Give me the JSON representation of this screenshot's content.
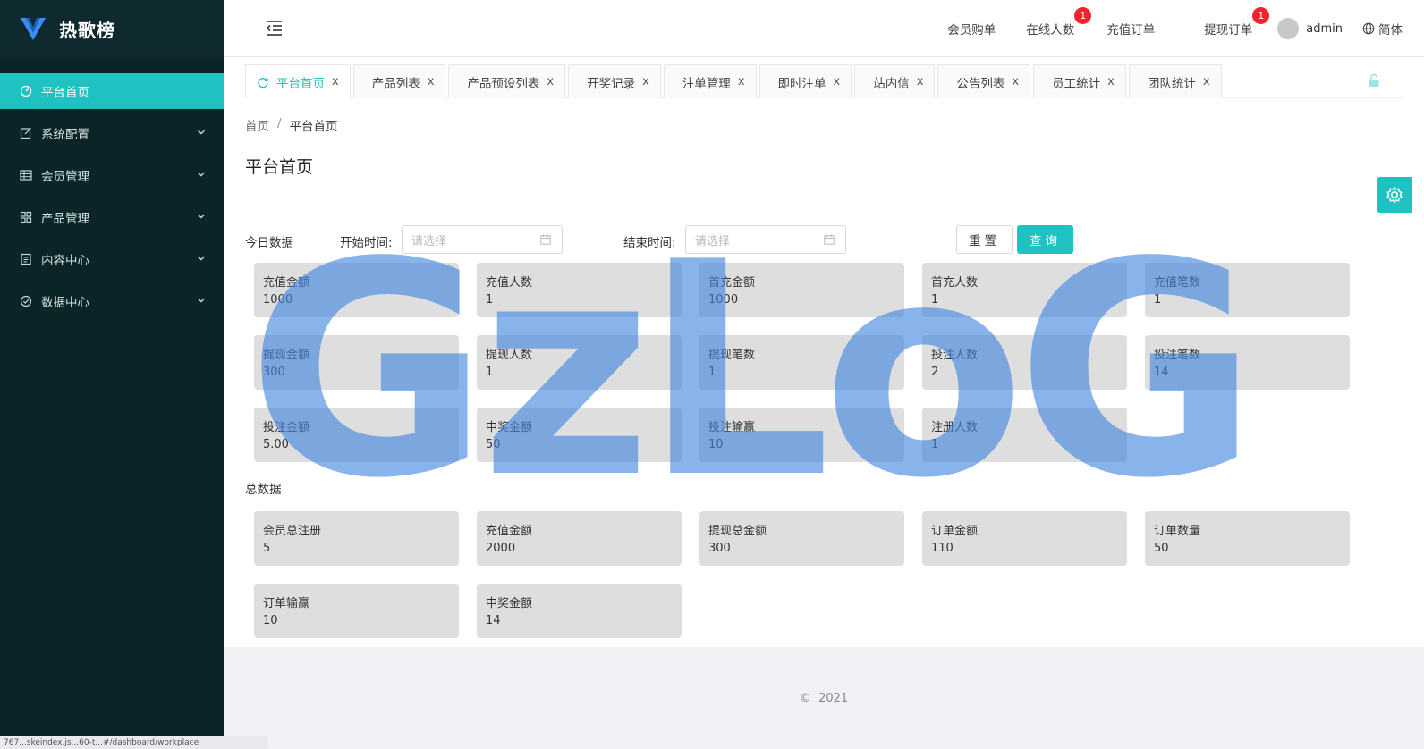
{
  "app": {
    "name": "热歌榜"
  },
  "sidebar": {
    "items": [
      {
        "label": "平台首页",
        "icon": "dashboard-icon"
      },
      {
        "label": "系统配置",
        "icon": "edit-icon"
      },
      {
        "label": "会员管理",
        "icon": "table-icon"
      },
      {
        "label": "产品管理",
        "icon": "grid-icon"
      },
      {
        "label": "内容中心",
        "icon": "document-icon"
      },
      {
        "label": "数据中心",
        "icon": "check-circle-icon"
      }
    ]
  },
  "header": {
    "nav": [
      {
        "label": "会员购单"
      },
      {
        "label": "在线人数",
        "badge": "1"
      },
      {
        "label": "充值订单"
      },
      {
        "label": "提现订单",
        "badge": "1"
      }
    ],
    "user": "admin",
    "lang": "简体"
  },
  "tabs": [
    {
      "label": "平台首页",
      "close": "x"
    },
    {
      "label": "产品列表",
      "close": "x"
    },
    {
      "label": "产品预设列表",
      "close": "x"
    },
    {
      "label": "开奖记录",
      "close": "x"
    },
    {
      "label": "注单管理",
      "close": "x"
    },
    {
      "label": "即时注单",
      "close": "x"
    },
    {
      "label": "站内信",
      "close": "x"
    },
    {
      "label": "公告列表",
      "close": "x"
    },
    {
      "label": "员工统计",
      "close": "x"
    },
    {
      "label": "团队统计",
      "close": "x"
    }
  ],
  "breadcrumb": {
    "home": "首页",
    "sep": "/",
    "current": "平台首页"
  },
  "page_title": "平台首页",
  "filter": {
    "section_label": "今日数据",
    "start_label": "开始时间:",
    "end_label": "结束时间:",
    "placeholder": "请选择",
    "reset": "重置",
    "query": "查询"
  },
  "today_cards": [
    {
      "label": "充值金额",
      "value": "1000"
    },
    {
      "label": "充值人数",
      "value": "1"
    },
    {
      "label": "首充金额",
      "value": "1000"
    },
    {
      "label": "首充人数",
      "value": "1"
    },
    {
      "label": "充值笔数",
      "value": "1"
    },
    {
      "label": "提现金额",
      "value": "300"
    },
    {
      "label": "提现人数",
      "value": "1"
    },
    {
      "label": "提现笔数",
      "value": "1"
    },
    {
      "label": "投注人数",
      "value": "2"
    },
    {
      "label": "投注笔数",
      "value": "14"
    },
    {
      "label": "投注金额",
      "value": "5.00"
    },
    {
      "label": "中奖金额",
      "value": "50"
    },
    {
      "label": "投注输赢",
      "value": "10"
    },
    {
      "label": "注册人数",
      "value": "1"
    }
  ],
  "total": {
    "section_label": "总数据",
    "cards": [
      {
        "label": "会员总注册",
        "value": "5"
      },
      {
        "label": "充值金额",
        "value": "2000"
      },
      {
        "label": "提现总金额",
        "value": "300"
      },
      {
        "label": "订单金额",
        "value": "110"
      },
      {
        "label": "订单数量",
        "value": "50"
      },
      {
        "label": "订单输赢",
        "value": "10"
      },
      {
        "label": "中奖金额",
        "value": "14"
      }
    ]
  },
  "footer": {
    "copyright": "2021"
  },
  "watermark": "GzLoG",
  "statusbar": "767...skeindex.js...60-t...#/dashboard/workplace",
  "colors": {
    "accent": "#1fc2c0",
    "sidebar_bg": "#0a2428",
    "badge": "#f5222d",
    "card_bg": "#dedede"
  }
}
